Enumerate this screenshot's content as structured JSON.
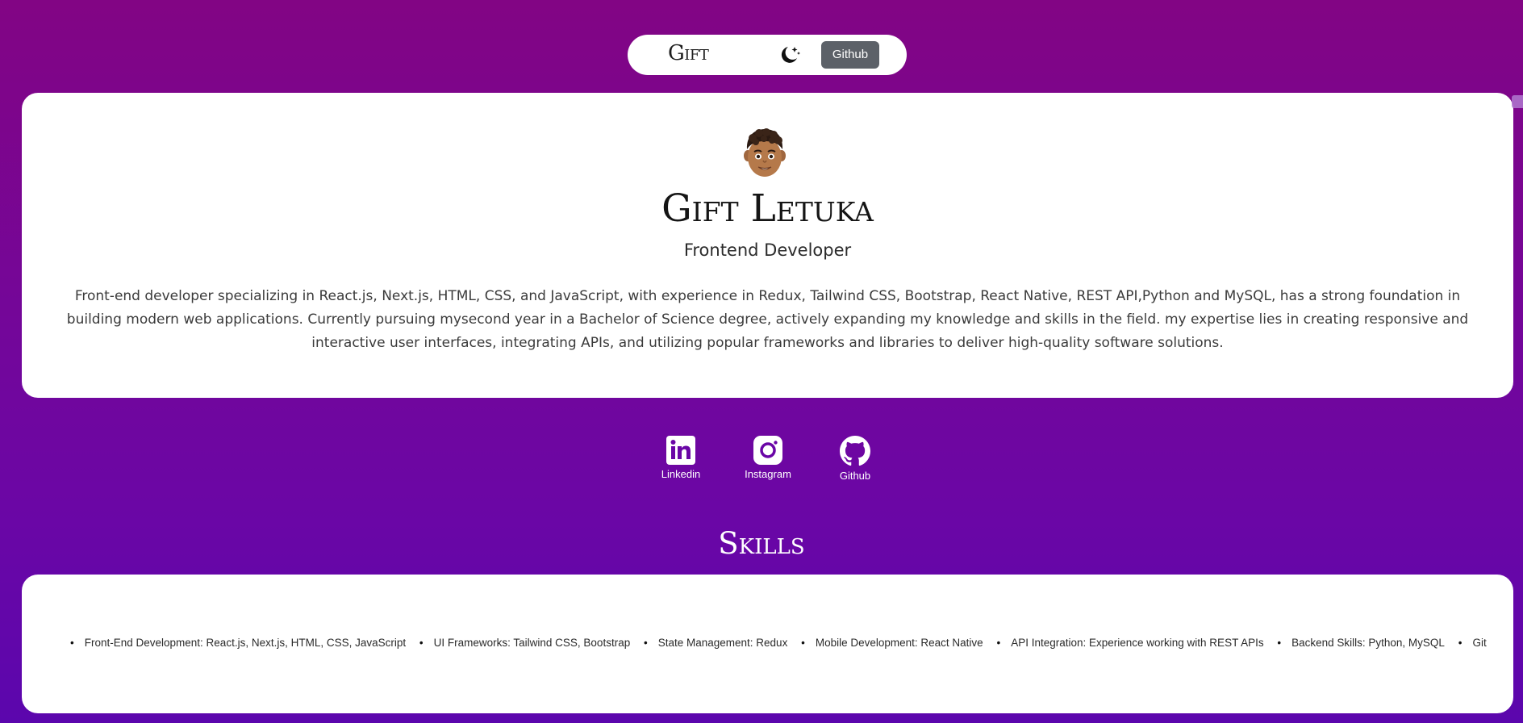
{
  "navbar": {
    "brand": "Gift",
    "theme_toggle_icon": "moon-stars-icon",
    "github_label": "Github"
  },
  "profile": {
    "avatar_icon": "memoji-avatar",
    "name": "Gift Letuka",
    "role": "Frontend Developer",
    "bio": "Front-end developer specializing in React.js, Next.js, HTML, CSS, and JavaScript, with experience in Redux, Tailwind CSS, Bootstrap, React Native, REST API,Python and MySQL, has a strong foundation in building modern web applications. Currently pursuing mysecond year in a Bachelor of Science degree, actively expanding my knowledge and skills in the field. my expertise lies in creating responsive and interactive user interfaces, integrating APIs, and utilizing popular frameworks and libraries to deliver high-quality software solutions."
  },
  "socials": [
    {
      "label": "Linkedin",
      "icon": "linkedin-icon"
    },
    {
      "label": "Instagram",
      "icon": "instagram-icon"
    },
    {
      "label": "Github",
      "icon": "github-icon"
    }
  ],
  "skills": {
    "heading": "Skills",
    "items": [
      "Front-End Development: React.js, Next.js, HTML, CSS, JavaScript",
      "UI Frameworks: Tailwind CSS, Bootstrap",
      "State Management: Redux",
      "Mobile Development: React Native",
      "API Integration: Experience working with REST APIs",
      "Backend Skills: Python, MySQL",
      "Git"
    ]
  },
  "colors": {
    "background_top": "#820584",
    "background_bottom": "#5b06ad",
    "card": "#ffffff",
    "github_button": "#5c6168"
  }
}
